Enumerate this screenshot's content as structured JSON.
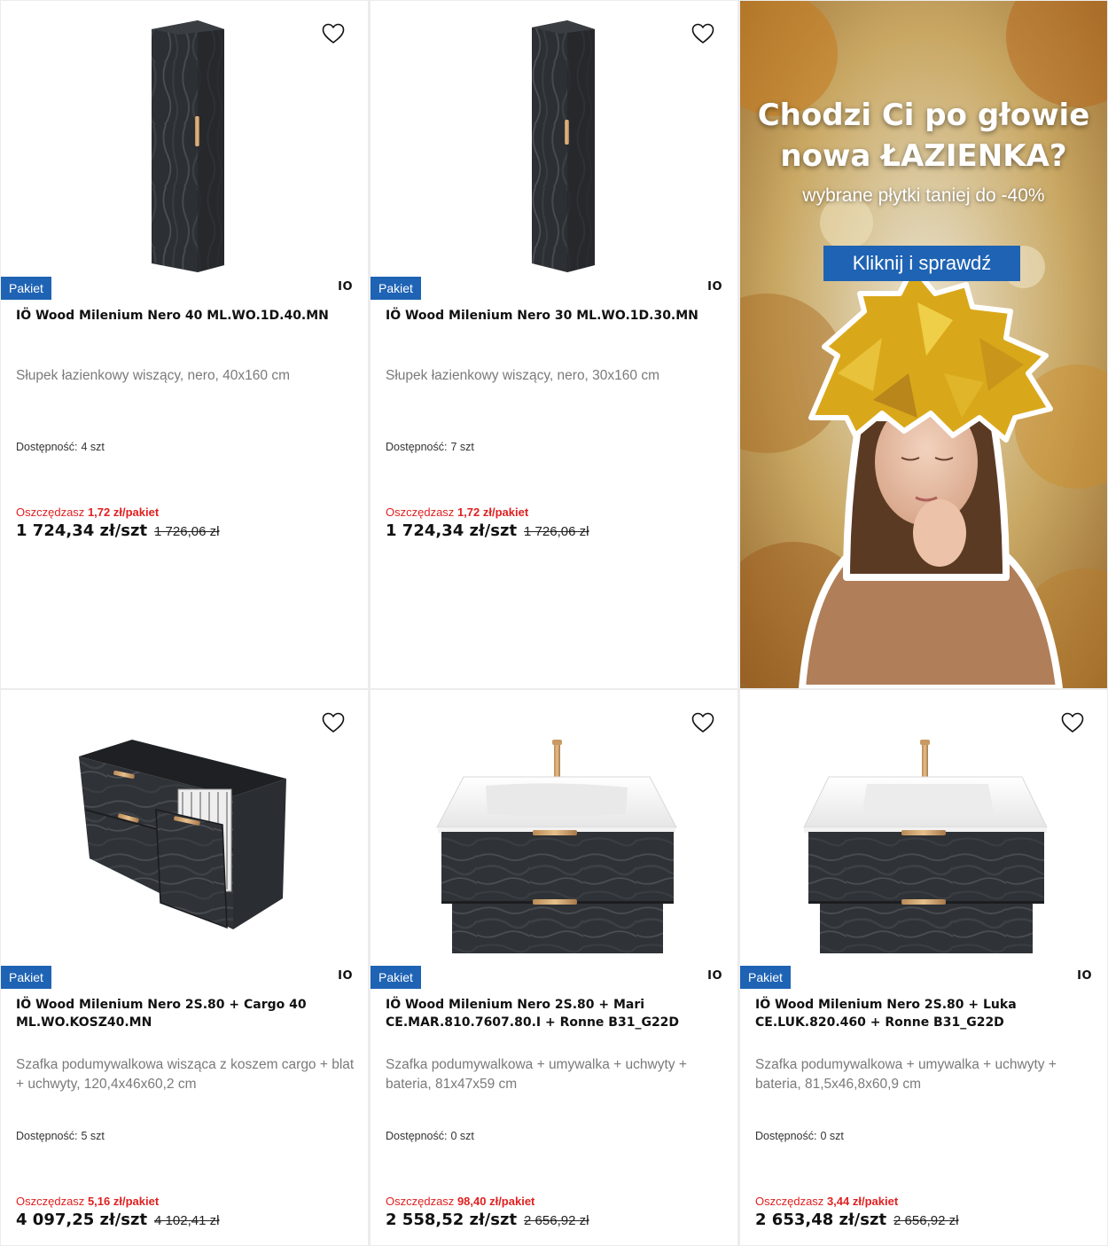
{
  "products": [
    {
      "badge": "Pakiet",
      "brand_logo": "IO",
      "title": "IÖ Wood Milenium Nero 40 ML.WO.1D.40.MN",
      "description": "Słupek łazienkowy wiszący, nero, 40x160 cm",
      "availability_label": "Dostępność:",
      "availability_value": "4 szt",
      "savings_label": "Oszczędzasz",
      "savings_value": "1,72 zł/pakiet",
      "price": "1 724,34 zł/szt",
      "old_price": "1 726,06 zł",
      "image": "tall-cabinet-40"
    },
    {
      "badge": "Pakiet",
      "brand_logo": "IO",
      "title": "IÖ Wood Milenium Nero 30 ML.WO.1D.30.MN",
      "description": "Słupek łazienkowy wiszący, nero, 30x160 cm",
      "availability_label": "Dostępność:",
      "availability_value": "7 szt",
      "savings_label": "Oszczędzasz",
      "savings_value": "1,72 zł/pakiet",
      "price": "1 724,34 zł/szt",
      "old_price": "1 726,06 zł",
      "image": "tall-cabinet-30"
    },
    {
      "badge": "Pakiet",
      "brand_logo": "IO",
      "title": "IÖ Wood Milenium Nero 2S.80 + Cargo 40 ML.WO.KOSZ40.MN",
      "description": "Szafka podumywalkowa wisząca z koszem cargo + blat + uchwyty, 120,4x46x60,2 cm",
      "availability_label": "Dostępność:",
      "availability_value": "5 szt",
      "savings_label": "Oszczędzasz",
      "savings_value": "5,16 zł/pakiet",
      "price": "4 097,25 zł/szt",
      "old_price": "4 102,41 zł",
      "image": "cargo-cabinet"
    },
    {
      "badge": "Pakiet",
      "brand_logo": "IO",
      "title": "IÖ Wood Milenium Nero 2S.80 + Mari CE.MAR.810.7607.80.I + Ronne B31_G22D",
      "description": "Szafka podumywalkowa + umywalka + uchwyty + bateria, 81x47x59 cm",
      "availability_label": "Dostępność:",
      "availability_value": "0 szt",
      "savings_label": "Oszczędzasz",
      "savings_value": "98,40 zł/pakiet",
      "price": "2 558,52 zł/szt",
      "old_price": "2 656,92 zł",
      "image": "vanity-mari"
    },
    {
      "badge": "Pakiet",
      "brand_logo": "IO",
      "title": "IÖ Wood Milenium Nero 2S.80 + Luka CE.LUK.820.460 + Ronne B31_G22D",
      "description": "Szafka podumywalkowa + umywalka + uchwyty + bateria, 81,5x46,8x60,9 cm",
      "availability_label": "Dostępność:",
      "availability_value": "0 szt",
      "savings_label": "Oszczędzasz",
      "savings_value": "3,44 zł/pakiet",
      "price": "2 653,48 zł/szt",
      "old_price": "2 656,92 zł",
      "image": "vanity-luka"
    }
  ],
  "banner": {
    "headline_line1": "Chodzi Ci po głowie",
    "headline_line2": "nowa ŁAZIENKA?",
    "subline": "wybrane płytki taniej do -40%",
    "cta": "Kliknij i sprawdź",
    "image": "autumn-woman-leaf-crown"
  },
  "icons": {
    "favorite": "heart-outline-icon"
  },
  "colors": {
    "badge": "#1f63b4",
    "savings": "#e02020",
    "cta": "#1f63b4"
  }
}
